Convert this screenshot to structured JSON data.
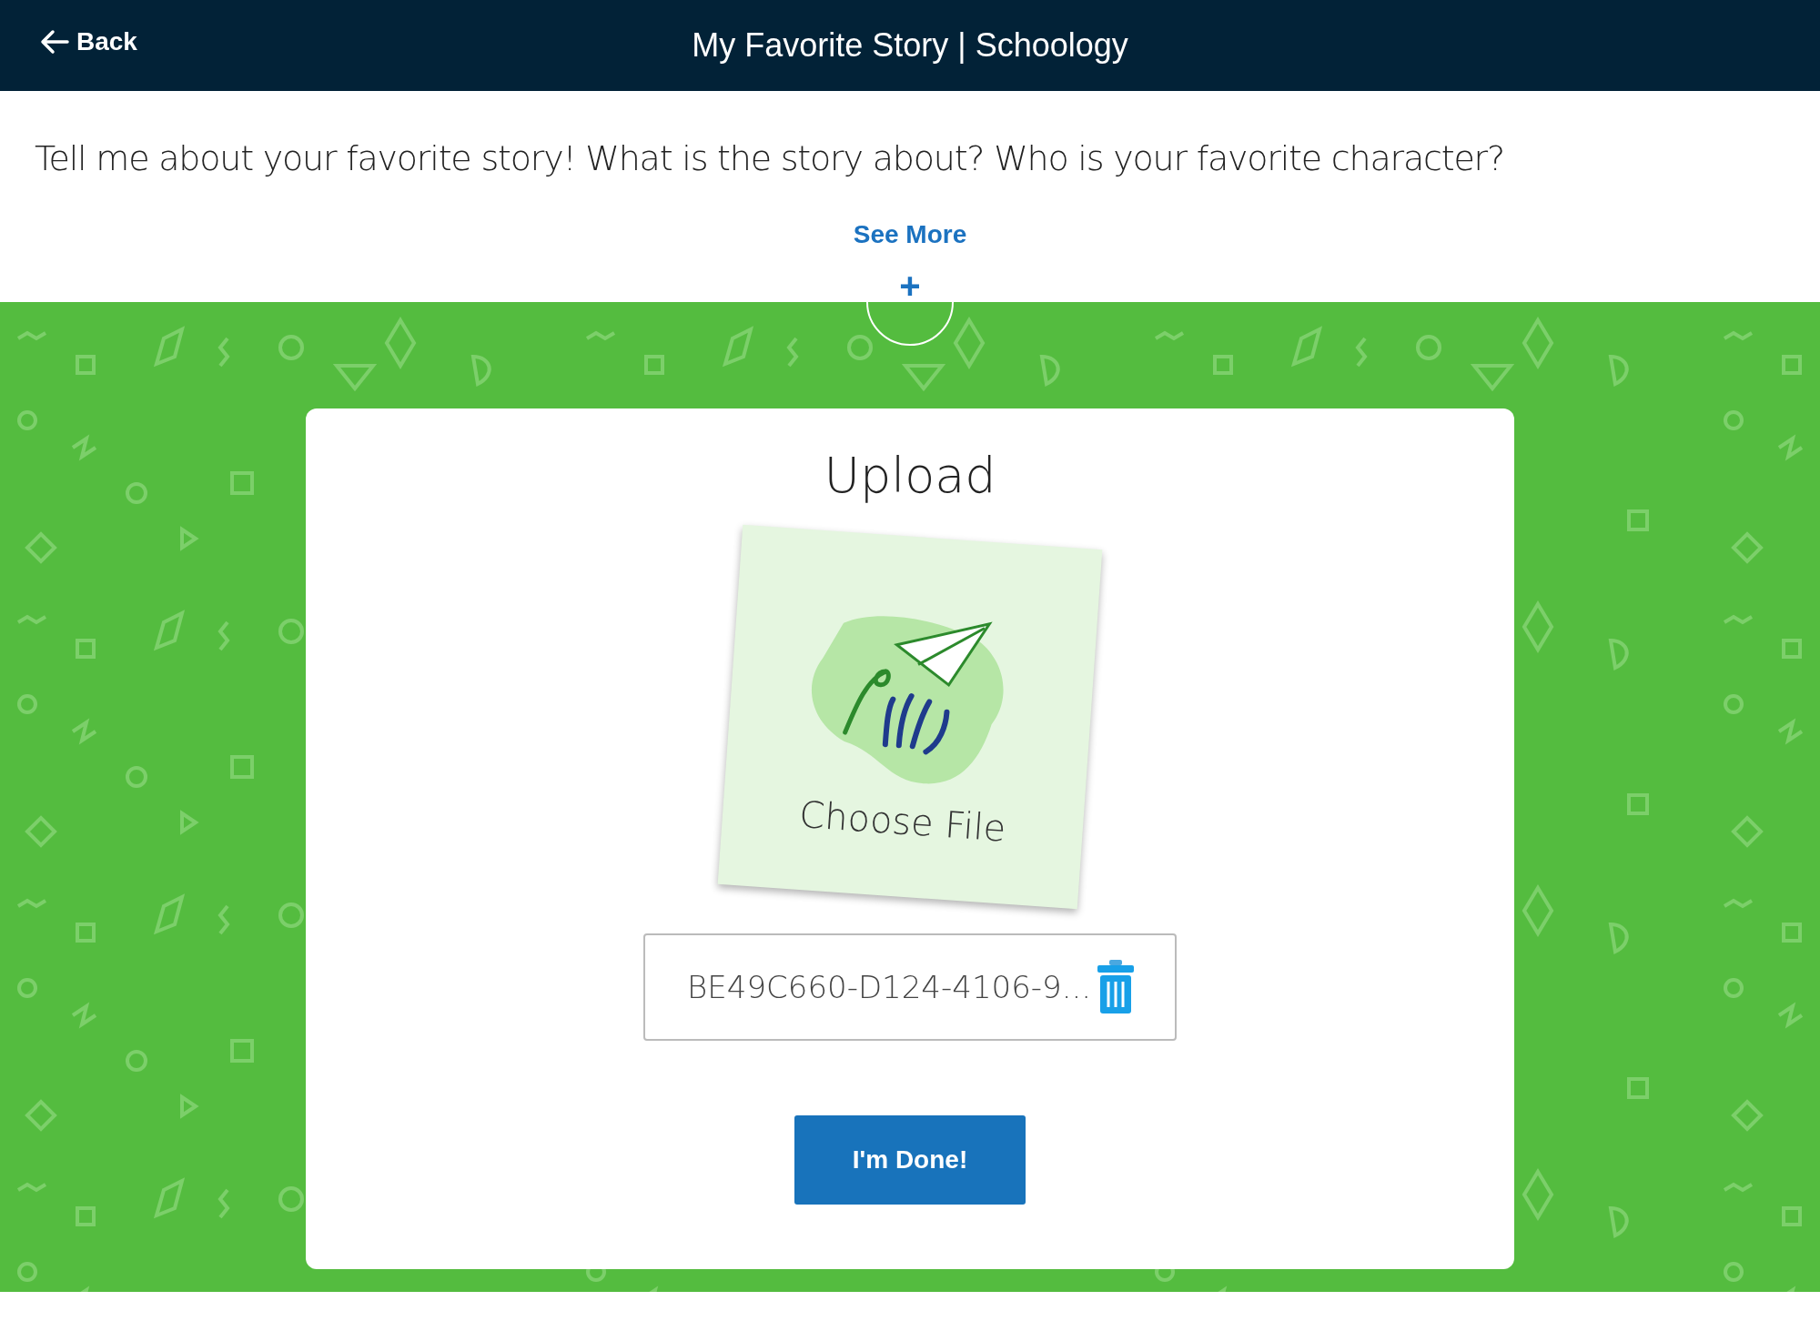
{
  "header": {
    "back_label": "Back",
    "title": "My Favorite Story | Schoology"
  },
  "prompt": {
    "text": "Tell me about your favorite story! What is the story about? Who is your favorite character?",
    "see_more": "See More",
    "expand_symbol": "+"
  },
  "upload": {
    "title": "Upload",
    "choose_file": "Choose File",
    "file_value": "BE49C660-D124-4106-9...",
    "done_button": "I'm Done!"
  }
}
